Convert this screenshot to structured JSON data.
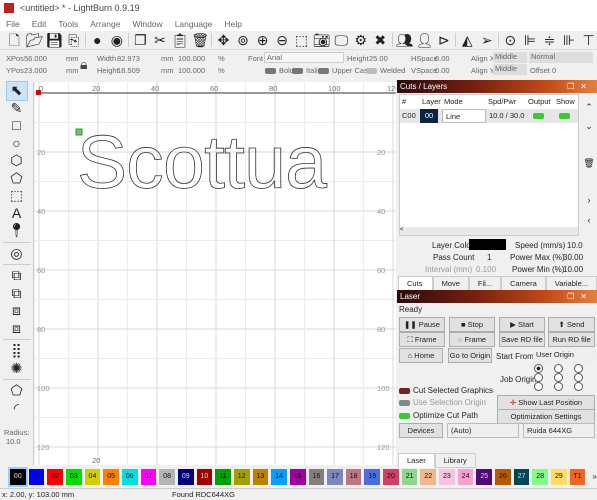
{
  "window": {
    "title": "<untitled> * - LightBurn 0.9.19"
  },
  "menu": [
    "File",
    "Edit",
    "Tools",
    "Arrange",
    "Window",
    "Language",
    "Help"
  ],
  "toolbar_icons": [
    "new-file",
    "open-folder",
    "save",
    "import",
    "circle-cw",
    "circle-ccw",
    "copy",
    "cut",
    "paste",
    "delete",
    "move",
    "zoom-fit",
    "zoom-in",
    "zoom-out",
    "select-frame",
    "camera",
    "monitor",
    "settings",
    "tools",
    "group",
    "user",
    "flip-h",
    "mirror",
    "send",
    "target",
    "align-left",
    "align-center",
    "align-right",
    "align-top"
  ],
  "props": {
    "xpos_label": "XPos",
    "xpos": "56.000",
    "ypos_label": "YPos",
    "ypos": "23.000",
    "unit": "mm",
    "width_label": "Width",
    "width": "82.973",
    "height_label": "Height",
    "height": "18.509",
    "scale_x": "100.000",
    "scale_y": "100.000",
    "pct": "%",
    "font_label": "Font",
    "font": "Arial",
    "text_height_label": "Height",
    "text_height": "25.00",
    "hspace_label": "HSpace",
    "hspace": "0.00",
    "vspace_label": "VSpace",
    "vspace": "0.00",
    "alignx_label": "Align X",
    "alignx": "Middle",
    "aligny_label": "Align Y",
    "aligny": "Middle",
    "mode": "Normal",
    "offset": "Offset 0",
    "bold": "Bold",
    "italic": "Italic",
    "upper": "Upper Case",
    "welded": "Welded"
  },
  "left_tools": [
    "select",
    "pencil",
    "rectangle",
    "ellipse",
    "polygon",
    "node-edit",
    "frame",
    "text",
    "position-pin",
    "offset",
    "union",
    "subtract",
    "intersect",
    "weld",
    "grid-array",
    "circular-array",
    "convert-path",
    "corner-round"
  ],
  "radius": {
    "label": "Radius:",
    "value": "10.0"
  },
  "canvas": {
    "text": "Scottua",
    "x_ticks": [
      "0",
      "20",
      "40",
      "60",
      "80",
      "100",
      "120"
    ],
    "y_ticks": [
      "20",
      "40",
      "60",
      "80",
      "100",
      "120"
    ],
    "bottom_tick": "20"
  },
  "cuts": {
    "title": "Cuts / Layers",
    "headers": [
      "#",
      "Layer",
      "Mode",
      "Spd/Pwr",
      "Output",
      "Show"
    ],
    "rows": [
      {
        "num": "C00",
        "layer": "00",
        "mode": "Line",
        "spdpwr": "10.0 / 30.0",
        "output": true,
        "show": true
      }
    ],
    "layer_color_label": "Layer Color",
    "layer_color": "#000000",
    "pass_count_label": "Pass Count",
    "pass_count": "1",
    "interval_label": "Interval (mm)",
    "interval": "0.100",
    "speed_label": "Speed (mm/s)",
    "speed": "10.0",
    "pmax_label": "Power Max (%)",
    "pmax": "30.00",
    "pmin_label": "Power Min (%)",
    "pmin": "10.00",
    "tabs": [
      "Cuts / L...",
      "Move",
      "Fil...",
      "Camera C...",
      "Variable..."
    ]
  },
  "laser": {
    "title": "Laser",
    "status": "Ready",
    "pause": "Pause",
    "stop": "Stop",
    "start": "Start",
    "send": "Send",
    "frame1": "Frame",
    "frame2": "Frame",
    "save_rd": "Save RD file",
    "run_rd": "Run RD file",
    "home": "Home",
    "goto_origin": "Go to Origin",
    "start_from_label": "Start From:",
    "start_from": "User Origin",
    "job_origin_label": "Job Origin",
    "cut_selected": "Cut Selected Graphics",
    "use_selection_origin": "Use Selection Origin",
    "optimize": "Optimize Cut Path",
    "show_last": "Show Last Position",
    "opt_settings": "Optimization Settings",
    "devices": "Devices",
    "port": "(Auto)",
    "device": "Ruida 644XG",
    "tabs": [
      "Laser",
      "Library"
    ]
  },
  "palette": [
    {
      "l": "00",
      "c": "#000000"
    },
    {
      "l": "01",
      "c": "#0000ff"
    },
    {
      "l": "02",
      "c": "#ff0000"
    },
    {
      "l": "03",
      "c": "#00e000"
    },
    {
      "l": "04",
      "c": "#d0d000"
    },
    {
      "l": "05",
      "c": "#ff8000"
    },
    {
      "l": "06",
      "c": "#00e0e0"
    },
    {
      "l": "07",
      "c": "#ff00ff"
    },
    {
      "l": "08",
      "c": "#b4b4b4"
    },
    {
      "l": "09",
      "c": "#000080"
    },
    {
      "l": "10",
      "c": "#a00000"
    },
    {
      "l": "11",
      "c": "#00a000"
    },
    {
      "l": "12",
      "c": "#a0a000"
    },
    {
      "l": "13",
      "c": "#c08000"
    },
    {
      "l": "14",
      "c": "#00a0ff"
    },
    {
      "l": "15",
      "c": "#a000a0"
    },
    {
      "l": "16",
      "c": "#808080"
    },
    {
      "l": "17",
      "c": "#7d87b9"
    },
    {
      "l": "18",
      "c": "#bb7784"
    },
    {
      "l": "19",
      "c": "#4a6fe3"
    },
    {
      "l": "20",
      "c": "#d33f6a"
    },
    {
      "l": "21",
      "c": "#8cd78c"
    },
    {
      "l": "22",
      "c": "#f0b98d"
    },
    {
      "l": "23",
      "c": "#f6c4e1"
    },
    {
      "l": "24",
      "c": "#fa9ed4"
    },
    {
      "l": "25",
      "c": "#500a78"
    },
    {
      "l": "26",
      "c": "#b45a00"
    },
    {
      "l": "27",
      "c": "#004754"
    },
    {
      "l": "28",
      "c": "#86fa88"
    },
    {
      "l": "29",
      "c": "#ffdb66"
    },
    {
      "l": "T1",
      "c": "#f26522"
    }
  ],
  "status": {
    "coords": "x: 2.00, y: 103.00 mm",
    "message": "Found RDC644XG"
  }
}
